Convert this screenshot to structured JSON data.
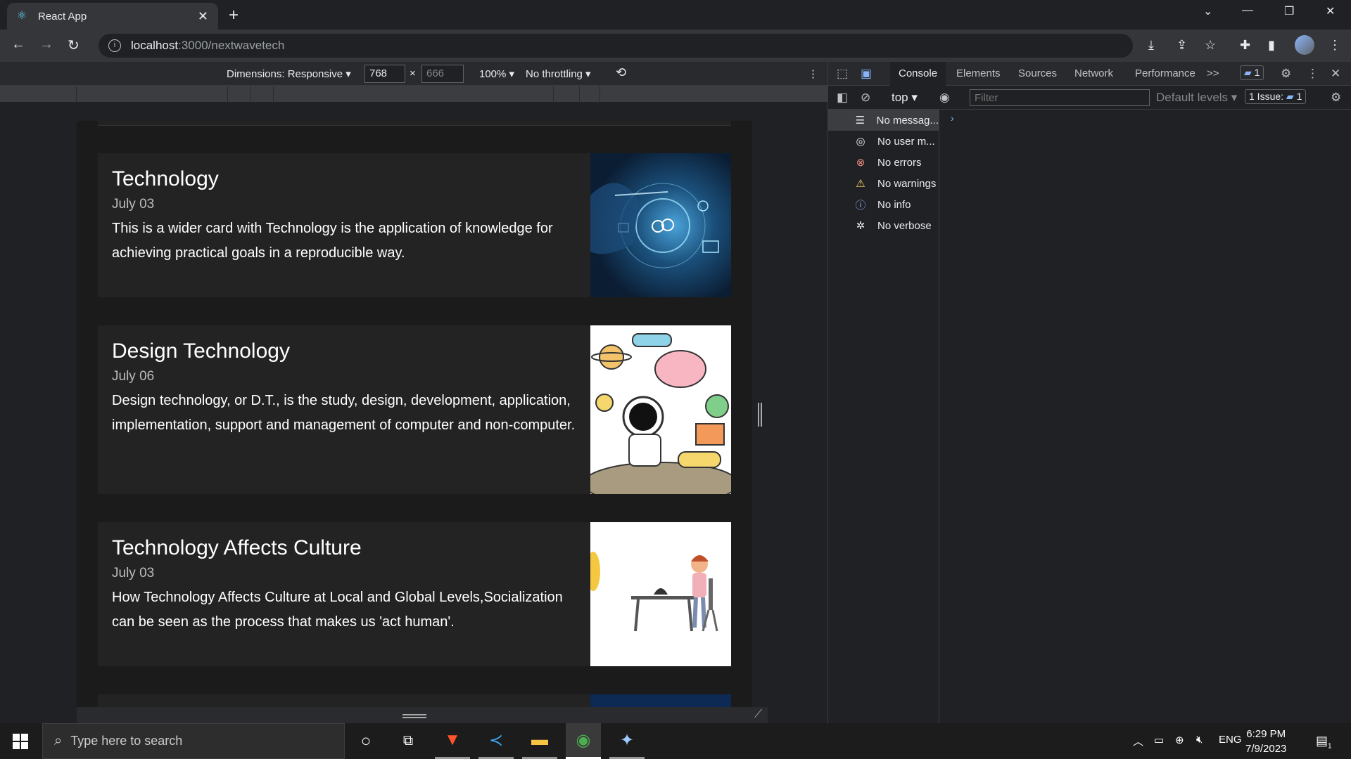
{
  "browser": {
    "tab_title": "React App",
    "url_host": "localhost",
    "url_path": ":3000/nextwavetech"
  },
  "device_toolbar": {
    "dimensions": "Dimensions: Responsive",
    "width": "768",
    "times": "×",
    "height": "666",
    "zoom": "100%",
    "throttling": "No throttling"
  },
  "cards": [
    {
      "title": "Technology",
      "date": "July 03",
      "description": "This is a wider card with Technology is the application of knowledge for achieving practical goals in a reproducible way."
    },
    {
      "title": "Design Technology",
      "date": "July 06",
      "description": "Design technology, or D.T., is the study, design, development, application, implementation, support and management of computer and non-computer."
    },
    {
      "title": "Technology Affects Culture",
      "date": "July 03",
      "description": "How Technology Affects Culture at Local and Global Levels,Socialization can be seen as the process that makes us 'act human'."
    }
  ],
  "devtools": {
    "tabs": [
      "Console",
      "Elements",
      "Sources",
      "Network",
      "Performance"
    ],
    "more_tabs": ">>",
    "messages_badge": "1",
    "context": "top",
    "filter_placeholder": "Filter",
    "levels": "Default levels",
    "issues": "1 Issue:",
    "issues_count": "1",
    "sidebar": [
      {
        "icon": "list-icon",
        "label": "No messag..."
      },
      {
        "icon": "user-icon",
        "label": "No user m..."
      },
      {
        "icon": "error-icon",
        "label": "No errors"
      },
      {
        "icon": "warning-icon",
        "label": "No warnings"
      },
      {
        "icon": "info-icon",
        "label": "No info"
      },
      {
        "icon": "bug-icon",
        "label": "No verbose"
      }
    ]
  },
  "taskbar": {
    "search_placeholder": "Type here to search",
    "language": "ENG",
    "time": "6:29 PM",
    "date": "7/9/2023",
    "notifications": "1"
  },
  "colors": {
    "card_bg": "#232323",
    "page_bg": "#1b1b1b",
    "devtools_bg": "#202124",
    "accent": "#8ab4f8"
  }
}
